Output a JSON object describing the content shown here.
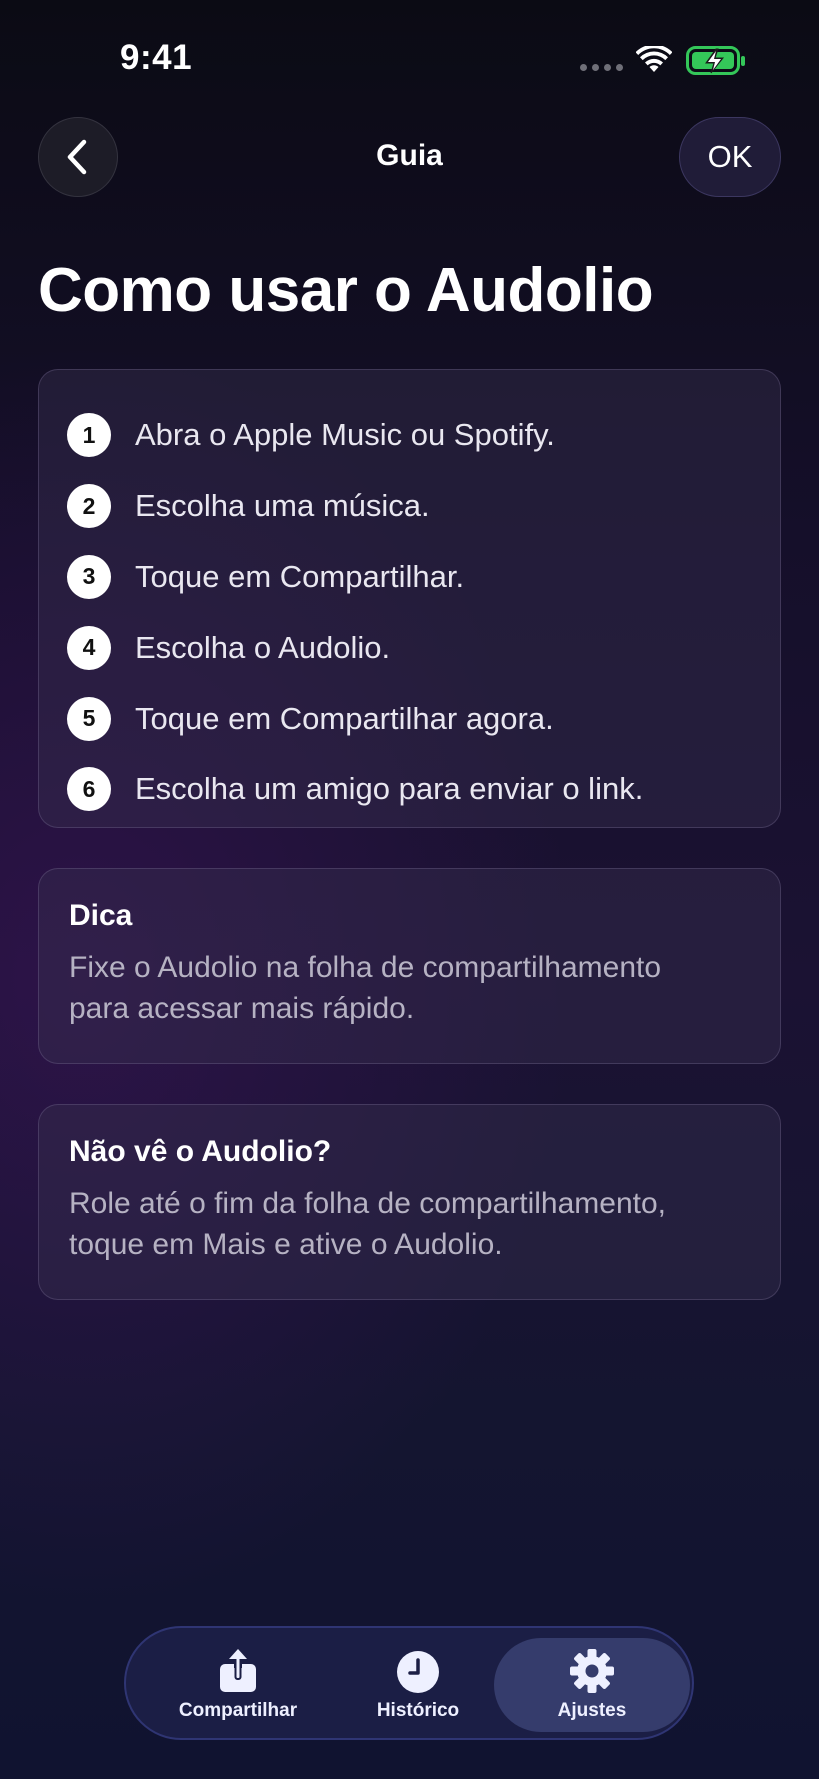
{
  "status_bar": {
    "time": "9:41"
  },
  "nav": {
    "title": "Guia",
    "ok_label": "OK"
  },
  "page": {
    "title": "Como usar o Audolio"
  },
  "steps": [
    {
      "number": "1",
      "text": "Abra o Apple Music ou Spotify."
    },
    {
      "number": "2",
      "text": "Escolha uma música."
    },
    {
      "number": "3",
      "text": "Toque em Compartilhar."
    },
    {
      "number": "4",
      "text": "Escolha o Audolio."
    },
    {
      "number": "5",
      "text": "Toque em Compartilhar agora."
    },
    {
      "number": "6",
      "text": "Escolha um amigo para enviar o link."
    }
  ],
  "tip": {
    "title": "Dica",
    "body_line1": "Fixe o Audolio na folha de compartilhamento",
    "body_line2": "para acessar mais rápido."
  },
  "help": {
    "title": "Não vê o Audolio?",
    "body_line1": "Role até o fim da folha de compartilhamento,",
    "body_line2": "toque em Mais e ative o Audolio."
  },
  "tabbar": {
    "items": [
      {
        "label": "Compartilhar",
        "icon": "share-icon"
      },
      {
        "label": "Histórico",
        "icon": "clock-icon"
      },
      {
        "label": "Ajustes",
        "icon": "gear-icon",
        "selected": true
      }
    ]
  },
  "colors": {
    "battery_green": "#34c759",
    "tabbar_accent": "#353c6c"
  }
}
